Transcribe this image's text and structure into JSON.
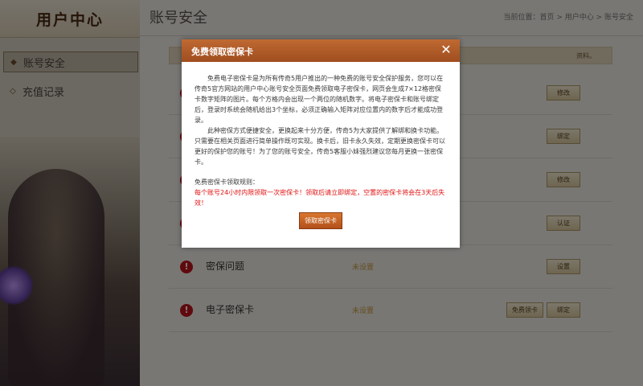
{
  "sidebar": {
    "title": "用户中心",
    "items": [
      {
        "label": "账号安全"
      },
      {
        "label": "充值记录"
      }
    ]
  },
  "main": {
    "title": "账号安全",
    "breadcrumb": "当前位置：首页 > 用户中心 > 账号安全",
    "info_bar": "资料。",
    "rows": [
      {
        "label": "",
        "status": "",
        "buttons": [
          "修改"
        ]
      },
      {
        "label": "",
        "status": "",
        "buttons": [
          "绑定"
        ]
      },
      {
        "label": "",
        "status": "",
        "buttons": [
          "修改"
        ]
      },
      {
        "label": "",
        "status": "",
        "buttons": [
          "认证"
        ]
      },
      {
        "label": "密保问题",
        "status": "未设置",
        "buttons": [
          "设置"
        ]
      },
      {
        "label": "电子密保卡",
        "status": "未设置",
        "buttons": [
          "免费领卡",
          "绑定"
        ]
      }
    ]
  },
  "modal": {
    "title": "免费领取密保卡",
    "close_glyph": "✕",
    "para1": "免费电子密保卡是为所有传奇5用户推出的一种免费的账号安全保护服务，您可以在传奇5官方网站的用户中心账号安全页面免费领取电子密保卡，网页会生成7×12格密保卡数字矩阵的图片。每个方格内会出现一个两位的随机数字。将电子密保卡和账号绑定后，登录时系统会随机给出3个坐标，必须正确输入矩阵对应位置内的数字后才能成功登录。",
    "para2": "此种密保方式便捷安全，更换起来十分方便，传奇5为大家提供了解绑和换卡功能。只需要在相关页面进行简单操作既可实现。换卡后，旧卡永久失效，定期更换密保卡可以更好的保护您的账号！为了您的账号安全，传奇5客服小妹强烈建议您每月更换一张密保卡。",
    "rules_title": "免费密保卡领取规则：",
    "rules_text": "每个账号24小时内限领取一次密保卡！领取后请立即绑定，空置的密保卡将会在3天后失效！",
    "claim_button": "领取密保卡"
  }
}
